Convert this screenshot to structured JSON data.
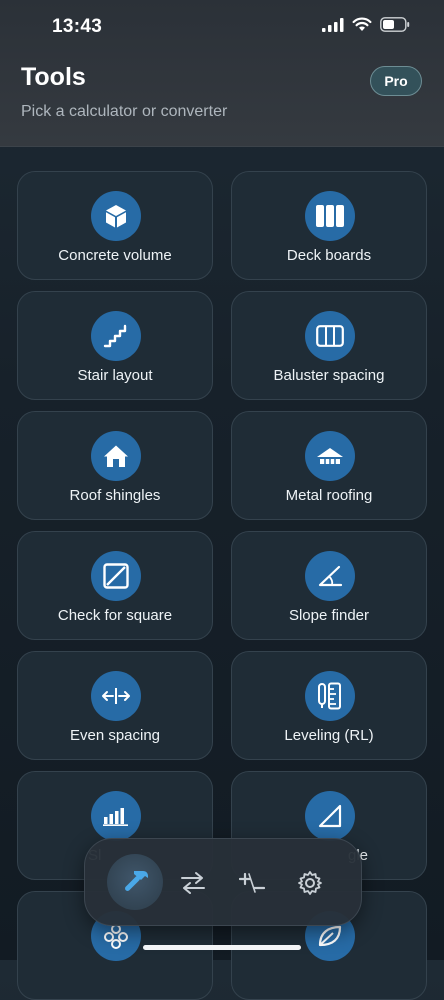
{
  "status": {
    "time": "13:43"
  },
  "header": {
    "title": "Tools",
    "subtitle": "Pick a calculator or converter",
    "pro_label": "Pro"
  },
  "tools": [
    {
      "label": "Concrete volume",
      "icon": "cube-icon"
    },
    {
      "label": "Deck boards",
      "icon": "deck-boards-icon"
    },
    {
      "label": "Stair layout",
      "icon": "stairs-icon"
    },
    {
      "label": "Baluster spacing",
      "icon": "baluster-icon"
    },
    {
      "label": "Roof shingles",
      "icon": "house-icon"
    },
    {
      "label": "Metal roofing",
      "icon": "metal-roof-icon"
    },
    {
      "label": "Check for square",
      "icon": "square-diagonal-icon"
    },
    {
      "label": "Slope finder",
      "icon": "angle-icon"
    },
    {
      "label": "Even spacing",
      "icon": "spacing-arrows-icon"
    },
    {
      "label": "Leveling (RL)",
      "icon": "level-ruler-icon"
    },
    {
      "label": "Sl",
      "icon": "bar-chart-icon"
    },
    {
      "label": "gle",
      "icon": "triangle-icon"
    },
    {
      "label": "",
      "icon": "dots-cluster-icon"
    },
    {
      "label": "",
      "icon": "leaf-icon"
    }
  ],
  "tabbar": {
    "tabs": [
      {
        "name": "tools",
        "icon": "hammer-icon",
        "active": true
      },
      {
        "name": "converter",
        "icon": "swap-arrows-icon",
        "active": false
      },
      {
        "name": "math",
        "icon": "plus-minus-icon",
        "active": false
      },
      {
        "name": "settings",
        "icon": "gear-icon",
        "active": false
      }
    ]
  },
  "colors": {
    "accent": "#276ba6",
    "tab_active_icon": "#4aa8e8"
  }
}
